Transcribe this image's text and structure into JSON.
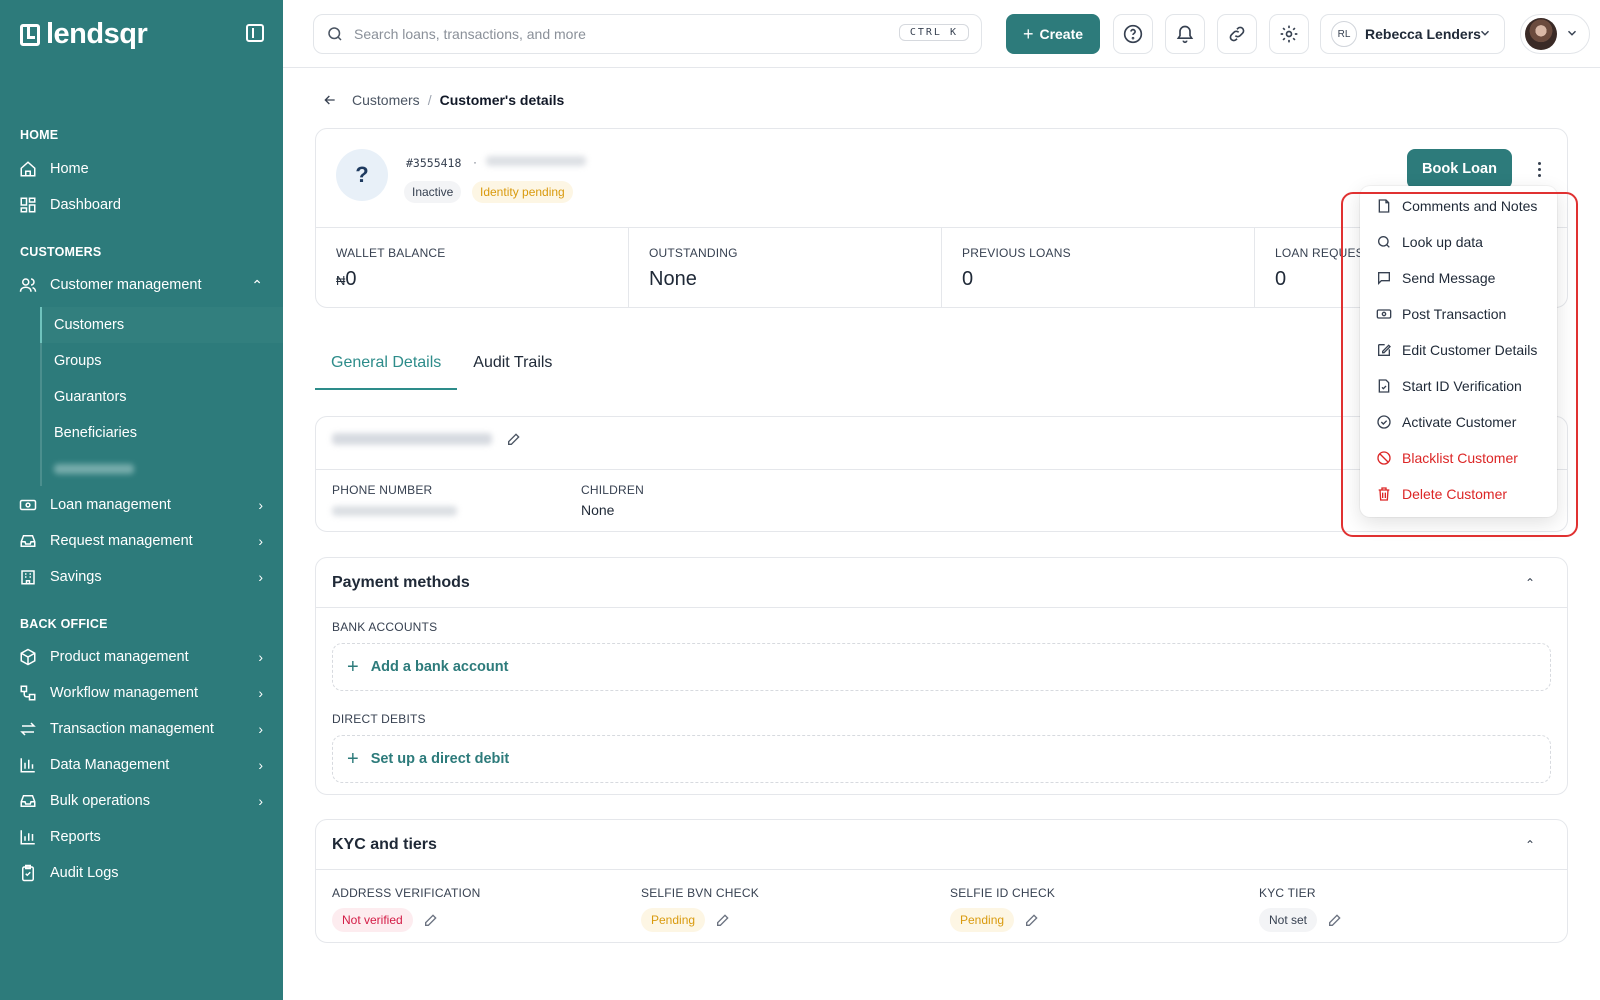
{
  "brand": {
    "name": "lendsqr"
  },
  "sidebar": {
    "sections": {
      "home": "HOME",
      "customers": "CUSTOMERS",
      "back_office": "BACK OFFICE"
    },
    "home_items": [
      "Home",
      "Dashboard"
    ],
    "customer_management": {
      "label": "Customer management",
      "sub_items": [
        "Customers",
        "Groups",
        "Guarantors",
        "Beneficiaries"
      ]
    },
    "customer_items": [
      "Loan management",
      "Request management",
      "Savings"
    ],
    "back_office_items": [
      "Product management",
      "Workflow management",
      "Transaction management",
      "Data Management",
      "Bulk operations",
      "Reports",
      "Audit Logs"
    ]
  },
  "topbar": {
    "search_placeholder": "Search loans, transactions, and more",
    "shortcut": "CTRL K",
    "create_label": "Create",
    "user_initials": "RL",
    "user_name": "Rebecca Lenders"
  },
  "breadcrumb": {
    "parent": "Customers",
    "separator": "/",
    "current": "Customer's details"
  },
  "customer": {
    "id": "#3555418",
    "dot": "·",
    "status": "Inactive",
    "identity_status": "Identity pending",
    "avatar_char": "?",
    "book_loan_label": "Book Loan",
    "stats": [
      {
        "label": "WALLET BALANCE",
        "currency": "₦",
        "value": "0"
      },
      {
        "label": "OUTSTANDING",
        "currency": "",
        "value": "None"
      },
      {
        "label": "PREVIOUS LOANS",
        "currency": "",
        "value": "0"
      },
      {
        "label": "LOAN REQUESTS",
        "currency": "",
        "value": "0"
      }
    ]
  },
  "tabs": [
    "General Details",
    "Audit Trails"
  ],
  "personal_info": {
    "fields": [
      {
        "label": "PHONE NUMBER"
      },
      {
        "label": "CHILDREN",
        "value": "None"
      }
    ]
  },
  "payment_methods": {
    "title": "Payment methods",
    "bank_accounts_label": "BANK ACCOUNTS",
    "add_bank_label": "Add a bank account",
    "direct_debits_label": "DIRECT DEBITS",
    "setup_debit_label": "Set up a direct debit"
  },
  "kyc": {
    "title": "KYC and tiers",
    "columns": [
      {
        "label": "ADDRESS VERIFICATION",
        "status": "Not verified"
      },
      {
        "label": "SELFIE BVN CHECK",
        "status": "Pending"
      },
      {
        "label": "SELFIE ID CHECK",
        "status": "Pending"
      },
      {
        "label": "KYC TIER",
        "status": "Not set"
      }
    ]
  },
  "actions_menu": [
    {
      "label": "Comments and Notes",
      "icon": "note-icon",
      "danger": false
    },
    {
      "label": "Look up data",
      "icon": "search-icon",
      "danger": false
    },
    {
      "label": "Send Message",
      "icon": "message-icon",
      "danger": false
    },
    {
      "label": "Post Transaction",
      "icon": "cash-icon",
      "danger": false
    },
    {
      "label": "Edit Customer Details",
      "icon": "edit-icon",
      "danger": false
    },
    {
      "label": "Start ID Verification",
      "icon": "file-check-icon",
      "danger": false
    },
    {
      "label": "Activate Customer",
      "icon": "check-circle-icon",
      "danger": false
    },
    {
      "label": "Blacklist Customer",
      "icon": "ban-icon",
      "danger": true
    },
    {
      "label": "Delete Customer",
      "icon": "trash-icon",
      "danger": true
    }
  ],
  "colors": {
    "brand": "#2d7b7b",
    "danger": "#dc2626",
    "highlight": "#e03131"
  }
}
